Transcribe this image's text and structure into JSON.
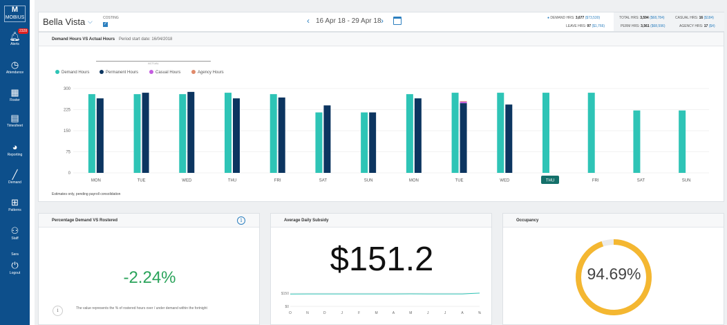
{
  "sidebar": {
    "logo_top": "MOBIUS",
    "logo_main": "M",
    "alerts_badge": "2328",
    "items": [
      {
        "label": "Alerts",
        "icon": "bell-icon"
      },
      {
        "label": "Attendance",
        "icon": "clock-icon"
      },
      {
        "label": "Roster",
        "icon": "calendar-icon"
      },
      {
        "label": "Timesheet",
        "icon": "timesheet-icon"
      },
      {
        "label": "Reporting",
        "icon": "pie-chart-icon"
      },
      {
        "label": "Demand",
        "icon": "line-chart-icon"
      },
      {
        "label": "Patterns",
        "icon": "grid-icon"
      },
      {
        "label": "Staff",
        "icon": "staff-icon"
      }
    ],
    "user": "Sara",
    "logout": "Logout"
  },
  "header": {
    "venue": "Bella Vista",
    "costing_label": "COSTING",
    "costing_checked": true,
    "date_range": "16 Apr 18 - 29 Apr 18",
    "summary": {
      "demand_label": "DEMAND HRS:",
      "demand_value": "3,677",
      "demand_cost": "($73,530)",
      "leave_label": "LEAVE HRS:",
      "leave_value": "97",
      "leave_cost": "($1,766)",
      "total_label": "TOTAL HRS:",
      "total_value": "3,594",
      "total_cost": "($68,784)",
      "perm_label": "PERM HRS:",
      "perm_value": "3,561",
      "perm_cost": "($68,596)",
      "casual_label": "CASUAL HRS:",
      "casual_value": "16",
      "casual_cost": "($184)",
      "agency_label": "AGENCY HRS:",
      "agency_value": "17",
      "agency_cost": "($4)"
    }
  },
  "main_chart": {
    "title": "Demand Hours VS Actual Hours",
    "subtitle": "Period start date: 16/04/2018",
    "actual_group_label": "ACTUAL",
    "footnote": "Estimates only, pending payroll consolidation"
  },
  "chart_data": [
    {
      "type": "bar",
      "categories": [
        "MON",
        "TUE",
        "WED",
        "THU",
        "FRI",
        "SAT",
        "SUN",
        "MON",
        "TUE",
        "WED",
        "THU",
        "FRI",
        "SAT",
        "SUN"
      ],
      "highlight_category_index": 10,
      "yticks": [
        0,
        75,
        150,
        225,
        300
      ],
      "ylim": [
        0,
        300
      ],
      "grid": true,
      "legend_position": "top-left",
      "series": [
        {
          "name": "Demand Hours",
          "color": "#2ec4b6",
          "values": [
            280,
            280,
            280,
            285,
            280,
            215,
            215,
            280,
            285,
            285,
            285,
            285,
            222,
            222
          ]
        },
        {
          "name": "Permanent Hours",
          "color": "#0c3560",
          "values": [
            265,
            285,
            288,
            265,
            268,
            240,
            215,
            265,
            248,
            243,
            null,
            null,
            null,
            null
          ]
        },
        {
          "name": "Casual Hours",
          "color": "#c45ce0",
          "values": [
            0,
            0,
            0,
            0,
            0,
            0,
            0,
            0,
            5,
            0,
            null,
            null,
            null,
            null
          ]
        },
        {
          "name": "Agency Hours",
          "color": "#e08a6b",
          "values": [
            0,
            0,
            0,
            0,
            0,
            0,
            0,
            0,
            2,
            0,
            null,
            null,
            null,
            null
          ]
        }
      ]
    },
    {
      "type": "line",
      "categories": [
        "O",
        "N",
        "D",
        "J",
        "F",
        "M",
        "A",
        "M",
        "J",
        "J",
        "A",
        "%"
      ],
      "yticks": [
        "$0",
        "$150"
      ],
      "ylim": [
        0,
        150
      ],
      "series": [
        {
          "name": "",
          "color": "#2ec4b6",
          "values": [
            140,
            141,
            141,
            141,
            141,
            141,
            141,
            142,
            141,
            141,
            141,
            151
          ]
        }
      ]
    },
    {
      "type": "pie",
      "title": "Occupancy",
      "values": [
        94.69,
        5.31
      ],
      "colors": [
        "#f4b731",
        "#ebebeb"
      ]
    }
  ],
  "cards": {
    "percentage": {
      "title": "Percentage Demand VS Rostered",
      "value": "-2.24%",
      "note": "The value represents the % of rostered hours over / under demand within the fortnight"
    },
    "subsidy": {
      "title": "Average Daily Subsidy",
      "value": "$151.2"
    },
    "occupancy": {
      "title": "Occupancy",
      "value": "94.69%"
    }
  }
}
